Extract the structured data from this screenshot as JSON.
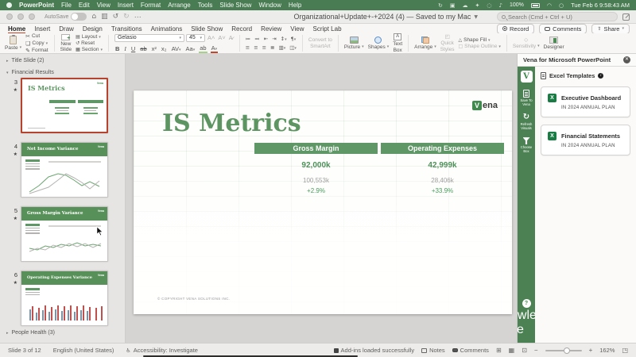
{
  "menubar": {
    "app": "PowerPoint",
    "items": [
      "File",
      "Edit",
      "View",
      "Insert",
      "Format",
      "Arrange",
      "Tools",
      "Slide Show",
      "Window",
      "Help"
    ],
    "battery_pct": "100%",
    "clock": "Tue Feb 6 9:58:43 AM"
  },
  "titlebar": {
    "autosave": "AutoSave",
    "doc_title": "Organizational+Update+-+2024 (4) — Saved to my Mac",
    "search_placeholder": "Search (Cmd + Ctrl + U)"
  },
  "ribbon": {
    "tabs": [
      "Home",
      "Insert",
      "Draw",
      "Design",
      "Transitions",
      "Animations",
      "Slide Show",
      "Record",
      "Review",
      "View",
      "Script Lab"
    ],
    "record_label": "Record",
    "comments_label": "Comments",
    "share_label": "Share",
    "paste": "Paste",
    "cut": "Cut",
    "copy": "Copy",
    "format": "Format",
    "new_slide_1": "New",
    "new_slide_2": "Slide",
    "layout": "Layout",
    "reset": "Reset",
    "section": "Section",
    "font_name": "Gelasio",
    "font_size": "45",
    "convert_1": "Convert to",
    "convert_2": "SmartArt",
    "picture": "Picture",
    "shapes": "Shapes",
    "text_box_1": "Text",
    "text_box_2": "Box",
    "arrange": "Arrange",
    "quick_styles_1": "Quick",
    "quick_styles_2": "Styles",
    "shape_fill": "Shape Fill",
    "shape_outline": "Shape Outline",
    "sensitivity": "Sensitivity",
    "designer": "Designer"
  },
  "slides_panel": {
    "section_title_slide": "Title Slide (2)",
    "section_financial": "Financial Results",
    "section_people": "People Health (3)",
    "brand": "Vena",
    "thumbs": [
      {
        "num": "3",
        "title": "IS Metrics"
      },
      {
        "num": "4",
        "title": "Net Income Variance"
      },
      {
        "num": "5",
        "title": "Gross Margin Variance"
      },
      {
        "num": "6",
        "title": "Operating Expenses Variance"
      }
    ]
  },
  "slide": {
    "title": "IS Metrics",
    "logo_v": "V",
    "logo_rest": "ena",
    "copyright": "© COPYRIGHT VENA SOLUTIONS INC.",
    "tables": [
      {
        "header": "Gross Margin",
        "primary": "92,000k",
        "secondary": "100,553k",
        "delta": "+2.9%"
      },
      {
        "header": "Operating Expenses",
        "primary": "42,999k",
        "secondary": "28,406k",
        "delta": "+33.9%"
      }
    ]
  },
  "vena_panel": {
    "title": "Vena for Microsoft PowerPoint",
    "logo_letter": "V",
    "tool_save": "Save To Vena",
    "tool_refresh": "Refresh Visuals",
    "tool_choose": "Choose Box",
    "tool_kb": "Knowledge Base",
    "section_label": "Excel Templates",
    "templates": [
      {
        "name": "Executive Dashboard",
        "plan": "IN 2024 ANNUAL PLAN"
      },
      {
        "name": "Financial Statements",
        "plan": "IN 2024 ANNUAL PLAN"
      }
    ]
  },
  "statusbar": {
    "slide_info": "Slide 3 of 12",
    "language": "English (United States)",
    "accessibility": "Accessibility: Investigate",
    "addins": "Add-ins loaded successfully",
    "notes": "Notes",
    "comments": "Comments",
    "zoom": "162%"
  },
  "colors": {
    "brand_green": "#4c8253",
    "accent_red": "#c3462e"
  }
}
